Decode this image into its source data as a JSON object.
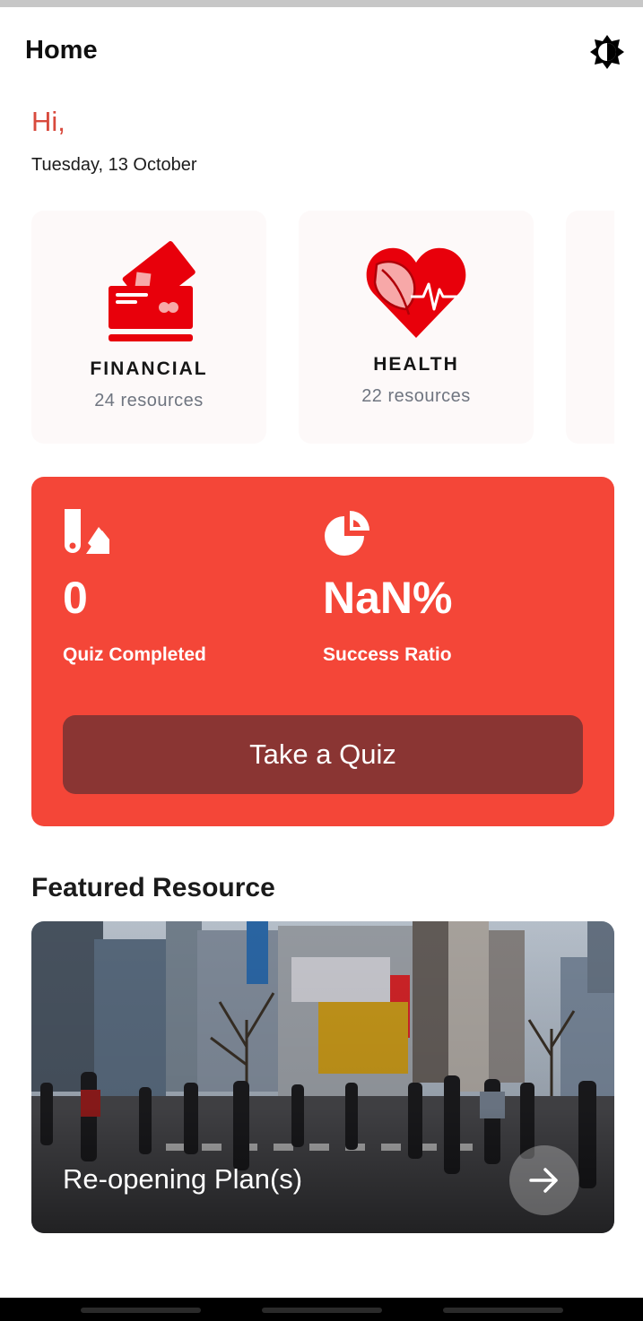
{
  "app_bar": {
    "title": "Home",
    "theme_icon": "brightness-icon"
  },
  "greeting": {
    "hello": "Hi,",
    "date": "Tuesday, 13 October"
  },
  "categories": [
    {
      "name": "FINANCIAL",
      "count": "24 resources",
      "icon": "credit-card-icon"
    },
    {
      "name": "HEALTH",
      "count": "22 resources",
      "icon": "heart-leaf-icon"
    }
  ],
  "stats": {
    "quiz_completed_value": "0",
    "quiz_completed_label": "Quiz Completed",
    "quiz_icon": "pencil-ruler-icon",
    "success_ratio_value": "NaN%",
    "success_ratio_label": "Success Ratio",
    "ratio_icon": "pie-chart-icon",
    "quiz_button_label": "Take a Quiz"
  },
  "featured": {
    "section_title": "Featured Resource",
    "title": "Re-opening Plan(s)",
    "arrow_icon": "arrow-right-icon"
  },
  "colors": {
    "accent": "#f44638",
    "button_dark": "#8a3533",
    "greeting": "#d84a3d",
    "icon_red": "#e8000b"
  }
}
